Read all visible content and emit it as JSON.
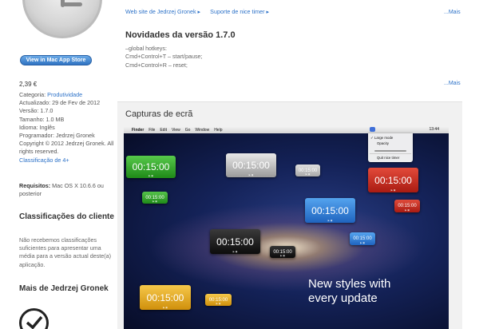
{
  "left": {
    "store_button": "View in Mac App Store",
    "price": "2,39 €",
    "info": {
      "category_label": "Categoria: ",
      "category_value": "Produtividade",
      "updated": "Actualizado: 29 de Fev de 2012",
      "version": "Versão: 1.7.0",
      "size": "Tamanho: 1.0 MB",
      "language": "Idioma: Inglês",
      "developer": "Programador: Jedrzej Gronek",
      "copyright": "Copyright © 2012 Jedrzej Gronek. All rights reserved.",
      "rating": "Classificação de 4+"
    },
    "requirements_label": "Requisitos:",
    "requirements_value": " Mac OS X 10.6.6 ou posterior",
    "ratings_title": "Classificações do cliente",
    "ratings_text": "Não recebemos classificações suficientes para apresentar uma média para a versão actual deste(a) aplicação.",
    "more_from_title": "Mais de Jedrzej Gronek"
  },
  "main": {
    "links": [
      "Web site de Jedrzej Gronek ▸",
      "Suporte de nice timer ▸"
    ],
    "more_label": "...Mais",
    "news_title": "Novidades da versão 1.7.0",
    "news_lines": [
      "–global hotkeys:",
      "Cmd+Control+T – start/pause;",
      "Cmd+Control+R – reset;"
    ],
    "more_label_2": "...Mais",
    "screenshots_title": "Capturas de ecrã"
  },
  "screenshot": {
    "menubar": {
      "apple": "",
      "items": [
        "Finder",
        "File",
        "Edit",
        "View",
        "Go",
        "Window",
        "Help"
      ],
      "clock": "13:44"
    },
    "dropdown": {
      "large_mode": "✓ Large mode",
      "opacity": "Opacity",
      "quit": "Quit nice timer"
    },
    "timer_text": "00:15:00",
    "slogan_line1": "New styles with",
    "slogan_line2": "every update"
  },
  "colors": {
    "link": "#2d72c8",
    "timer_green": "#2fa326",
    "timer_silver": "#b9b9b9",
    "timer_red": "#c9291e",
    "timer_blue": "#2b80d6",
    "timer_black": "#151515",
    "timer_yellow": "#e0a418"
  }
}
